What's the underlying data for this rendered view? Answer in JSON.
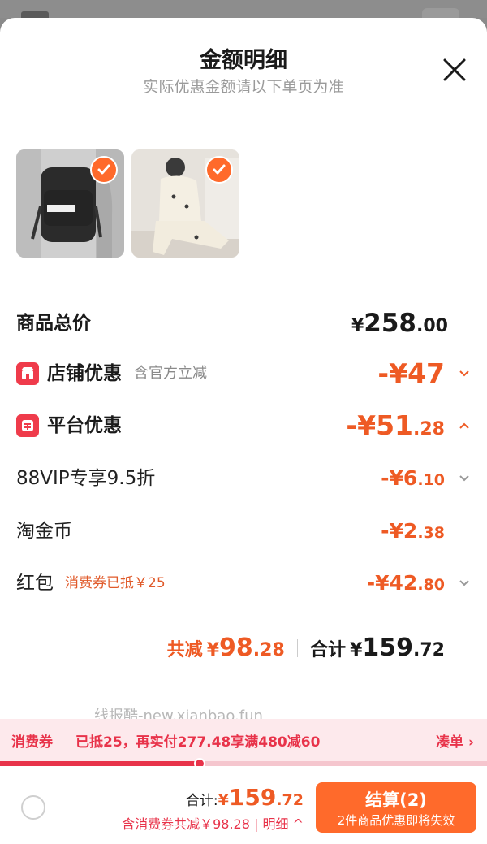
{
  "header": {
    "title": "金额明细",
    "subtitle": "实际优惠金额请以下单页为准"
  },
  "items": [
    {
      "name": "backpack-thumbnail",
      "selected": true
    },
    {
      "name": "pajamas-thumbnail",
      "selected": true
    }
  ],
  "price_rows": {
    "total": {
      "label": "商品总价",
      "currency": "¥",
      "int": "258",
      "dec": ".00"
    },
    "store_discount": {
      "label": "店铺优惠",
      "note": "含官方立减",
      "value": "-¥47"
    },
    "platform_discount": {
      "label": "平台优惠",
      "int": "-¥51",
      "dec": ".28"
    },
    "vip": {
      "label": "88VIP专享9.5折",
      "int": "-¥6",
      "dec": ".10"
    },
    "coin": {
      "label": "淘金币",
      "int": "-¥2",
      "dec": ".38"
    },
    "redpacket": {
      "label": "红包",
      "note": "消费券已抵￥25",
      "int": "-¥42",
      "dec": ".80"
    }
  },
  "summary": {
    "reduced_label": "共减",
    "reduced_cur": "¥",
    "reduced_int": "98",
    "reduced_dec": ".28",
    "total_label": "合计",
    "total_cur": "¥",
    "total_int": "159",
    "total_dec": ".72"
  },
  "watermark": "线报酷-new.xianbao.fun",
  "coupon_bar": {
    "tag": "消费券",
    "message": "已抵25，再实付277.48享满480减60",
    "action": "凑单"
  },
  "progress": {
    "fraction": 0.41
  },
  "footer": {
    "total_label": "合计:",
    "currency": "¥",
    "int": "159",
    "dec": ".72",
    "sub_text": "含消费券共减￥98.28",
    "detail": "明细",
    "checkout_label": "结算(2)",
    "checkout_sub": "2件商品优惠即将失效"
  },
  "colors": {
    "accent": "#ff6a2b",
    "discount": "#ee5a24",
    "coupon_red": "#e8334a"
  }
}
